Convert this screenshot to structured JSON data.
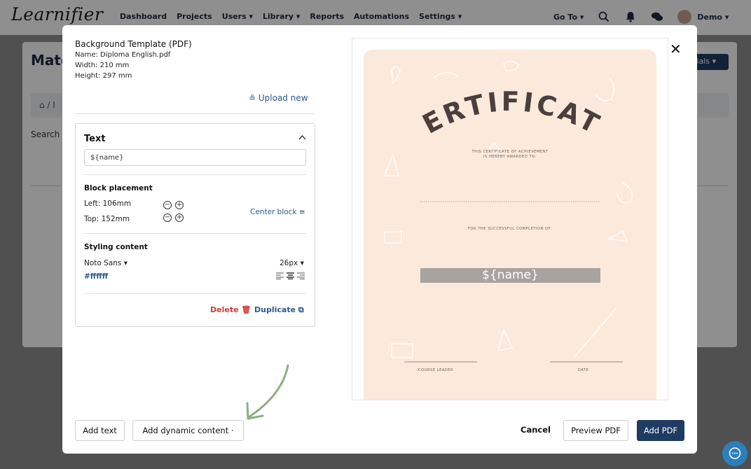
{
  "app": {
    "logo": "Learnifier"
  },
  "nav": {
    "items": [
      "Dashboard",
      "Projects",
      "Users ▾",
      "Library ▾",
      "Reports",
      "Automations",
      "Settings ▾"
    ],
    "goto": "Go To ▾",
    "user": "Demo ▾"
  },
  "background_page": {
    "title": "Mate",
    "materials_button": "rials ▾",
    "breadcrumb": "⌂ / I",
    "search_label": "Search"
  },
  "modal": {
    "template": {
      "title": "Background Template (PDF)",
      "name": "Name: Diploma English.pdf",
      "width": "Width: 210 mm",
      "height": "Height: 297 mm",
      "upload_new": "≗ Upload new"
    },
    "text_block": {
      "header": "Text",
      "value": "${name}",
      "placement_label": "Block placement",
      "left": "Left: 106mm",
      "top": "Top: 152mm",
      "center_block": "Center block ≡",
      "styling_label": "Styling content",
      "font": "Noto Sans ▾",
      "size": "26px ▾",
      "color": "#ffffff",
      "delete": "Delete 🗑",
      "duplicate": "Duplicate ⧉"
    },
    "preview": {
      "heading": "CERTIFICATE",
      "subtitle_1": "THIS CERTIFICATE OF ACHIEVEMENT",
      "subtitle_2": "IS HEREBY AWARDED TO:",
      "completion": "FOR THE SUCCESSFUL COMPLETION OF:",
      "name_placeholder": "${name}",
      "course_leader": "COURSE LEADER",
      "date": "DATE"
    },
    "actions": {
      "add_text": "Add text",
      "add_dynamic": "Add dynamic content ·",
      "cancel": "Cancel",
      "preview_pdf": "Preview PDF",
      "add_pdf": "Add PDF"
    }
  },
  "colors": {
    "primary": "#1f3b62",
    "link": "#2a5b8c",
    "danger": "#d43a3a",
    "certificate_bg": "#fbe9dc",
    "arrow": "#8cb07f"
  }
}
